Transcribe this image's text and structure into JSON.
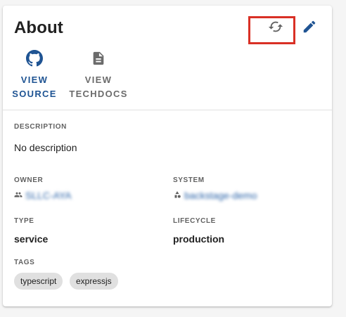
{
  "card": {
    "title": "About"
  },
  "header_actions": {
    "refresh_icon": "refresh-icon",
    "edit_icon": "pencil-icon",
    "highlight_color": "#d93025"
  },
  "links": [
    {
      "label_line1": "VIEW",
      "label_line2": "SOURCE",
      "icon": "github-icon",
      "color": "#1f5493"
    },
    {
      "label_line1": "VIEW",
      "label_line2": "TECHDOCS",
      "icon": "document-icon",
      "color": "#6b6b6b"
    }
  ],
  "fields": {
    "description": {
      "label": "DESCRIPTION",
      "value": "No description"
    },
    "owner": {
      "label": "OWNER",
      "value": "SLLC-AYA",
      "icon": "group-icon"
    },
    "system": {
      "label": "SYSTEM",
      "value": "backstage-demo",
      "icon": "system-icon"
    },
    "type": {
      "label": "TYPE",
      "value": "service"
    },
    "lifecycle": {
      "label": "LIFECYCLE",
      "value": "production"
    },
    "tags": {
      "label": "TAGS",
      "items": [
        "typescript",
        "expressjs"
      ]
    }
  },
  "colors": {
    "link_blue": "#1f5493",
    "text_dark": "#212121",
    "label_grey": "#616161",
    "chip_bg": "#e0e0e0"
  }
}
